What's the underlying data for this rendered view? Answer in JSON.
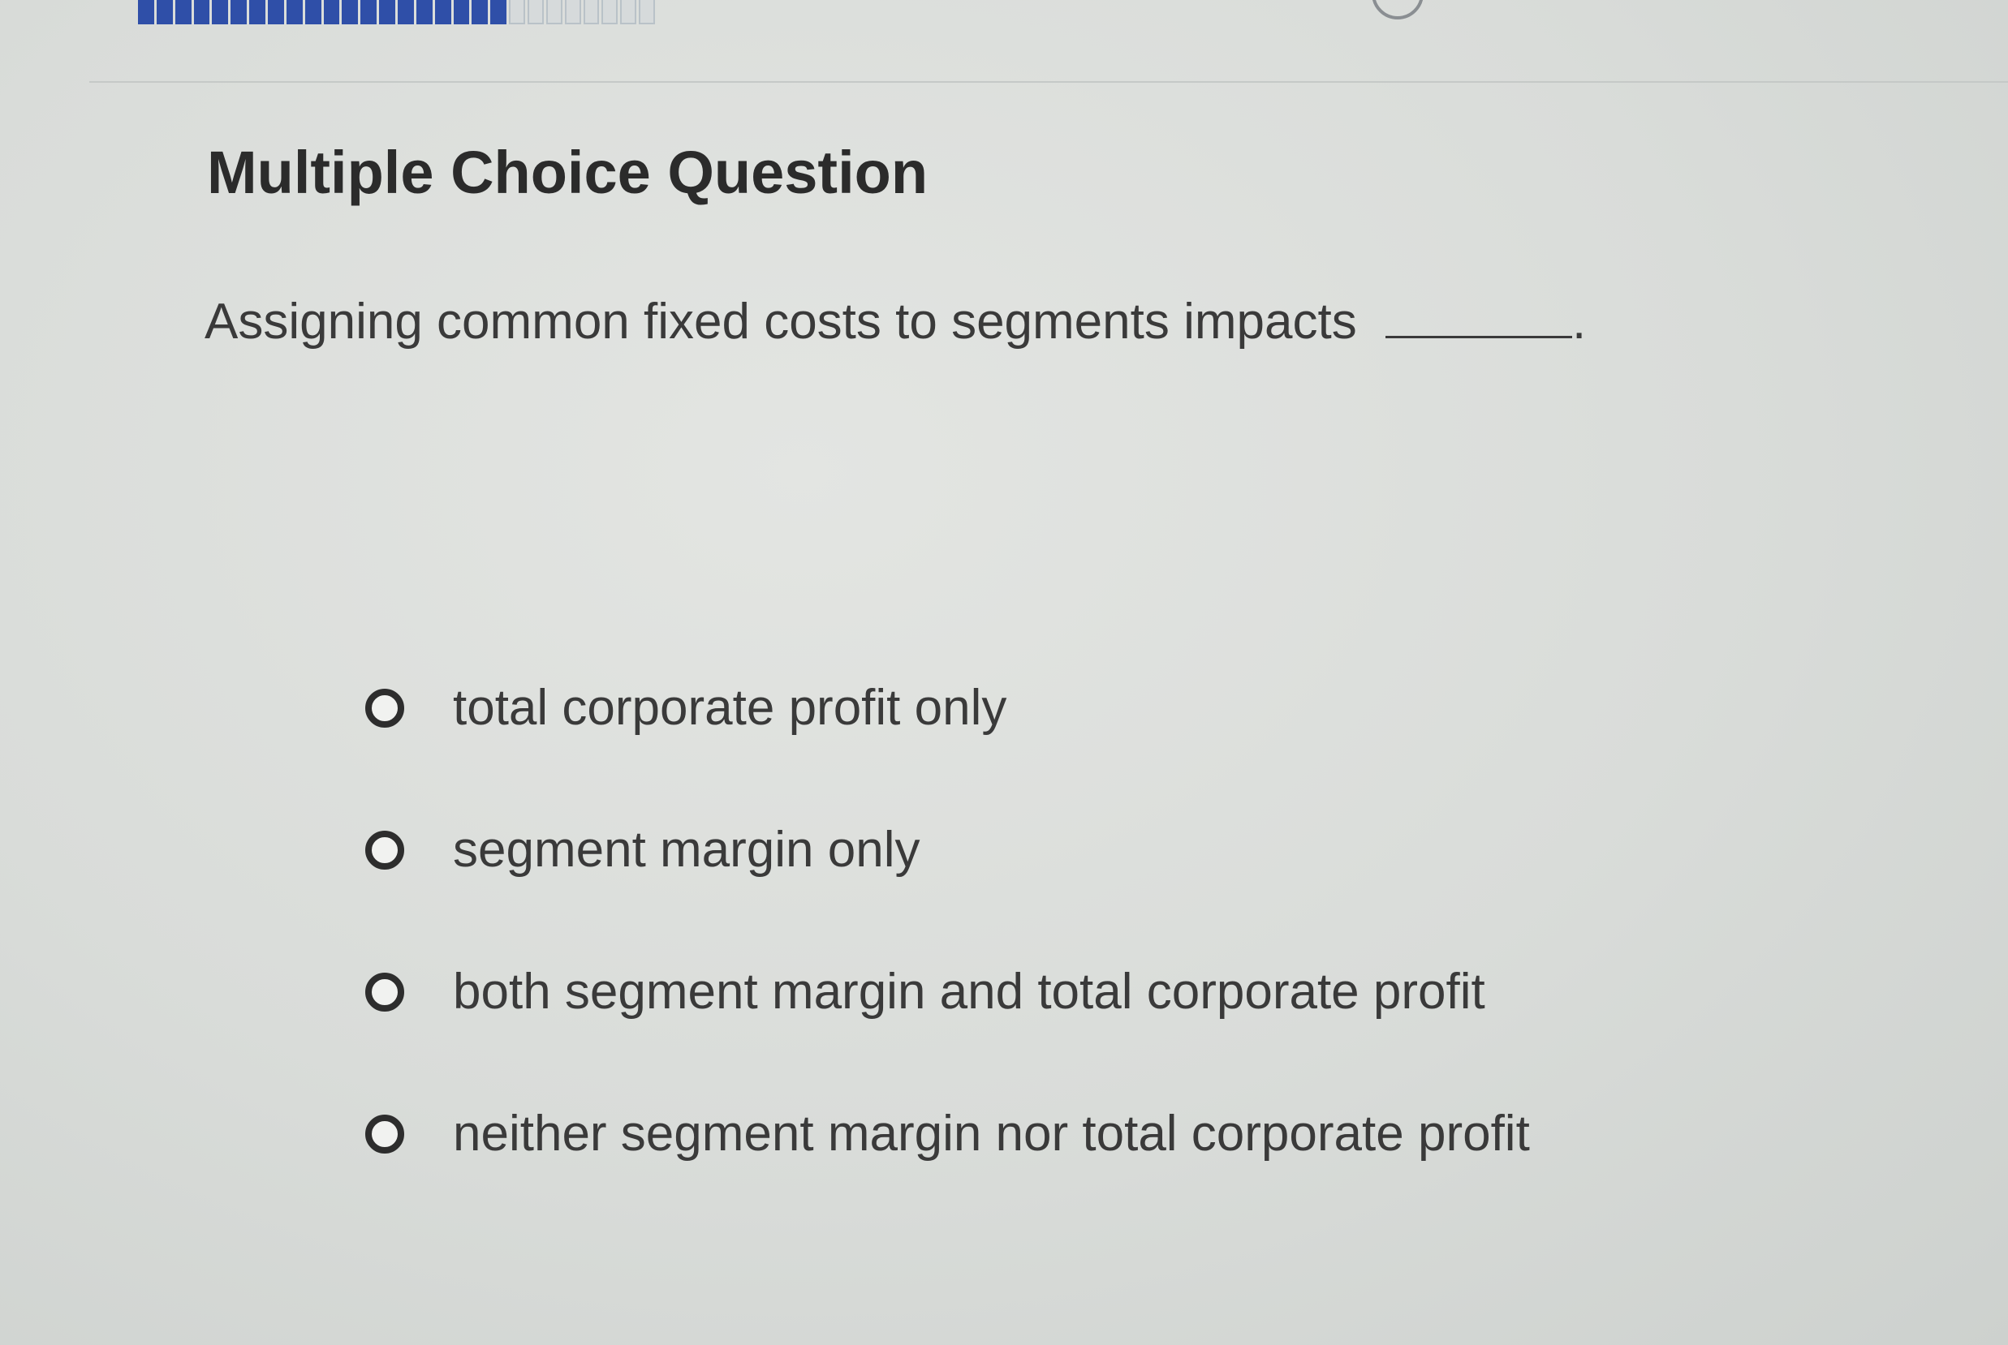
{
  "progress": {
    "segments_total": 28,
    "segments_completed": 20,
    "filled_color": "#2f4fa8",
    "status_text": "",
    "help_icon": "help-icon"
  },
  "question": {
    "title": "Multiple Choice Question",
    "prompt": "Assigning common fixed costs to segments impacts",
    "prompt_end": ".",
    "options": [
      {
        "label": "total corporate profit only",
        "selected": false
      },
      {
        "label": "segment margin only",
        "selected": false
      },
      {
        "label": "both segment margin and total corporate profit",
        "selected": false
      },
      {
        "label": "neither segment margin nor total corporate profit",
        "selected": false
      }
    ]
  }
}
